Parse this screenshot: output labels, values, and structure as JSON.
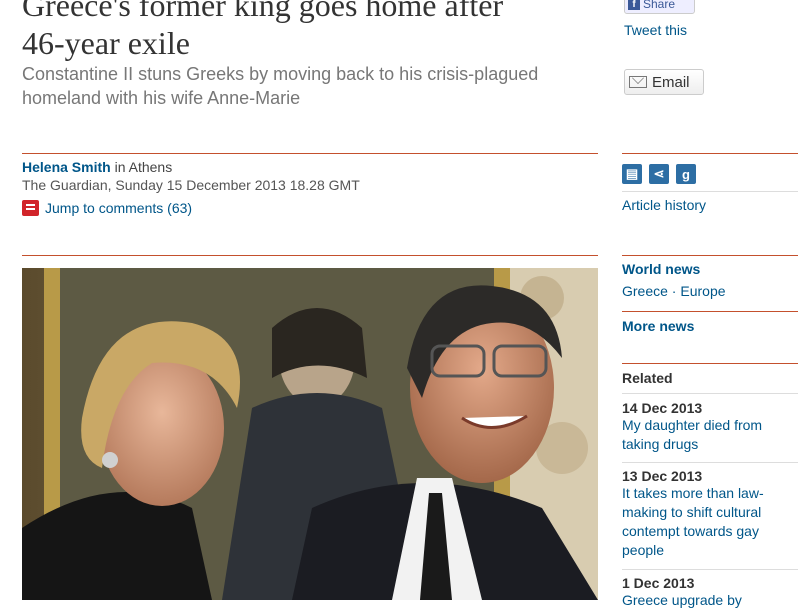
{
  "article": {
    "headline_line1": "Greece's former king goes home after",
    "headline_line2": "46-year exile",
    "standfirst": "Constantine II stuns Greeks by moving back to his crisis-plagued homeland with his wife Anne-Marie",
    "author": "Helena Smith",
    "author_location": " in Athens",
    "dateline": "The Guardian, Sunday 15 December 2013 18.28 GMT",
    "comments_link": "Jump to comments (63)"
  },
  "sidebar": {
    "facebook_share": "Share",
    "tweet": "Tweet this",
    "email": "Email",
    "article_history": "Article history",
    "world_news": "World news",
    "tags": [
      "Greece",
      "Europe"
    ],
    "tag_separator": " · ",
    "more_news": "More news",
    "related_title": "Related",
    "related": [
      {
        "date": "14 Dec 2013",
        "title": "My daughter died from taking drugs"
      },
      {
        "date": "13 Dec 2013",
        "title": "It takes more than law-making to shift cultural contempt towards gay people"
      },
      {
        "date": "1 Dec 2013",
        "title": "Greece upgrade by"
      }
    ]
  },
  "colors": {
    "accent_rule": "#c4502d",
    "link": "#005689"
  }
}
